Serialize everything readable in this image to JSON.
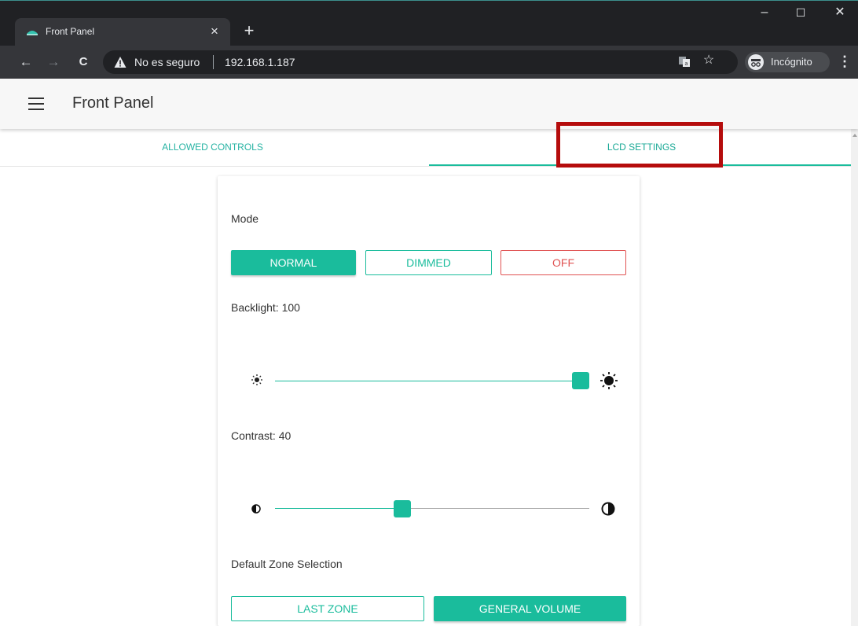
{
  "browser": {
    "tab_title": "Front Panel",
    "tab_close": "×",
    "new_tab": "+",
    "window_minimize": "–",
    "window_maximize": "☐",
    "window_close": "✕",
    "back": "←",
    "forward": "→",
    "reload": "C",
    "security_text": "No es seguro",
    "url": "192.168.1.187",
    "star": "☆",
    "incognito_label": "Incógnito",
    "menu": "⋮"
  },
  "app": {
    "title": "Front Panel",
    "tabs": [
      {
        "label": "ALLOWED CONTROLS",
        "selected": false
      },
      {
        "label": "LCD SETTINGS",
        "selected": true
      }
    ]
  },
  "lcd": {
    "mode_label": "Mode",
    "mode_options": [
      {
        "label": "NORMAL",
        "selected": true
      },
      {
        "label": "DIMMED",
        "selected": false
      },
      {
        "label": "OFF",
        "selected": false
      }
    ],
    "backlight_label": "Backlight: 100",
    "backlight_value": 100,
    "contrast_label": "Contrast: 40",
    "contrast_value": 40,
    "zone_label": "Default Zone Selection",
    "zone_options": [
      {
        "label": "LAST ZONE",
        "selected": false
      },
      {
        "label": "GENERAL VOLUME",
        "selected": true
      }
    ]
  },
  "colors": {
    "accent": "#1abc9c",
    "danger": "#e05353",
    "highlight": "#b50c0c"
  }
}
